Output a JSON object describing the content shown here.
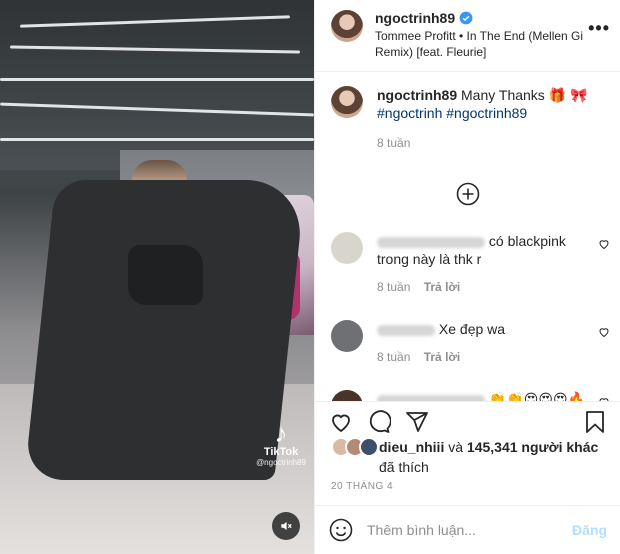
{
  "post": {
    "username": "ngoctrinh89",
    "music": "Tommee Profitt • In The End (Mellen Gi Remix) [feat. Fleurie]",
    "more_label": "•••"
  },
  "video": {
    "tiktok_logo": "♪",
    "tiktok_label": "TikTok",
    "tiktok_handle": "@ngoctrinh89"
  },
  "caption": {
    "username": "ngoctrinh89",
    "text": "Many Thanks 🎁 🎀",
    "hashtags": "#ngoctrinh #ngoctrinh89",
    "time": "8 tuần"
  },
  "comments": [
    {
      "text": "có blackpink trong này là thk r",
      "time": "8 tuần",
      "reply": "Trả lời",
      "avatar_color": "#d8d6cc"
    },
    {
      "text": "Xe đẹp wa",
      "time": "8 tuần",
      "reply": "Trả lời",
      "avatar_color": "#6f7073"
    },
    {
      "text": "👏👏😍😍😍🔥🔥🔥",
      "time": "",
      "reply": "",
      "avatar_color": "#4a3328"
    }
  ],
  "likes": {
    "names": "dieu_nhiii",
    "connector": "và",
    "count": "145,341 người khác",
    "suffix": "đã thích"
  },
  "date": "20 THÁNG 4",
  "add_comment": {
    "placeholder": "Thêm bình luận...",
    "post_label": "Đăng"
  },
  "colors": {
    "verified": "#3897f0",
    "hashtag": "#00376b",
    "muted": "#8e8e8e",
    "post_disabled": "#b2dffc"
  }
}
